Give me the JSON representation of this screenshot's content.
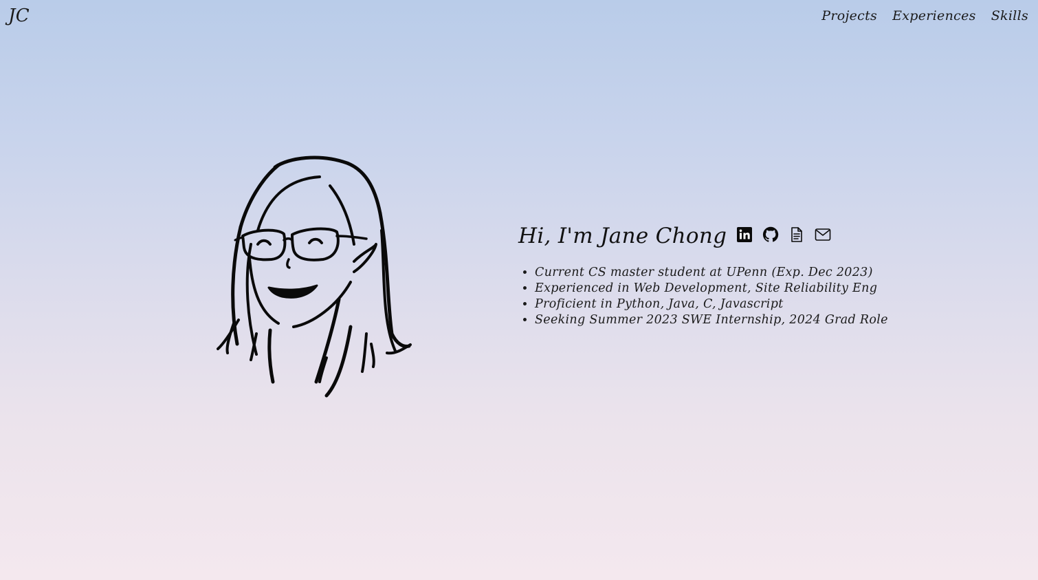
{
  "header": {
    "logo_text": "JC",
    "nav": [
      {
        "label": "Projects"
      },
      {
        "label": "Experiences"
      },
      {
        "label": "Skills"
      }
    ]
  },
  "hero": {
    "headline": "Hi, I'm Jane Chong",
    "social_icons": [
      {
        "icon": "linkedin-icon"
      },
      {
        "icon": "github-icon"
      },
      {
        "icon": "resume-document-icon"
      },
      {
        "icon": "email-icon"
      }
    ],
    "bullets": [
      "Current CS master student at UPenn (Exp. Dec 2023)",
      "Experienced in Web Development, Site Reliability Eng",
      "Proficient in Python, Java, C, Javascript",
      "Seeking Summer 2023 SWE Internship, 2024 Grad Role"
    ]
  },
  "colors": {
    "background_top": "#b9cce9",
    "background_bottom": "#f4e8ee",
    "text": "#111111"
  }
}
